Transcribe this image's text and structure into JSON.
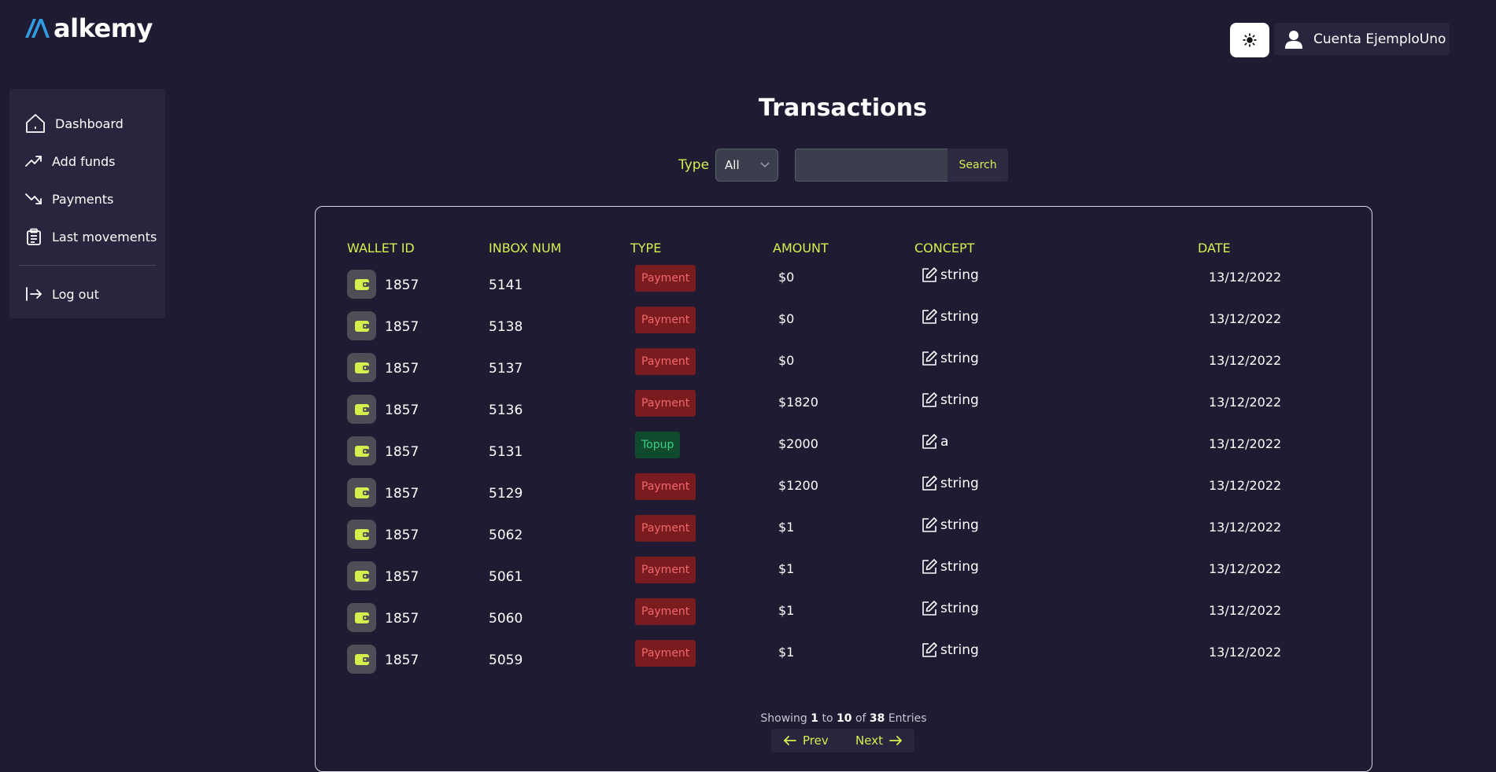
{
  "brand": {
    "name": "alkemy",
    "accent": "#2f9be0"
  },
  "header": {
    "theme_icon": "sun-icon",
    "account_name": "Cuenta EjemploUno",
    "account_icon": "user-icon"
  },
  "sidebar": {
    "items": [
      {
        "label": "Dashboard",
        "icon": "home-icon"
      },
      {
        "label": "Add funds",
        "icon": "trending-up-icon"
      },
      {
        "label": "Payments",
        "icon": "trending-down-icon"
      },
      {
        "label": "Last movements",
        "icon": "clipboard-icon"
      }
    ],
    "logout": {
      "label": "Log out",
      "icon": "logout-icon"
    }
  },
  "page": {
    "title": "Transactions"
  },
  "filters": {
    "type_label": "Type",
    "type_selected": "All",
    "search_value": "",
    "search_button": "Search"
  },
  "table": {
    "headers": [
      "WALLET ID",
      "INBOX NUM",
      "TYPE",
      "AMOUNT",
      "CONCEPT",
      "DATE"
    ],
    "rows": [
      {
        "wallet": "1857",
        "inbox": "5141",
        "type": "Payment",
        "amount": "$0",
        "concept": "string",
        "date": "13/12/2022"
      },
      {
        "wallet": "1857",
        "inbox": "5138",
        "type": "Payment",
        "amount": "$0",
        "concept": "string",
        "date": "13/12/2022"
      },
      {
        "wallet": "1857",
        "inbox": "5137",
        "type": "Payment",
        "amount": "$0",
        "concept": "string",
        "date": "13/12/2022"
      },
      {
        "wallet": "1857",
        "inbox": "5136",
        "type": "Payment",
        "amount": "$1820",
        "concept": "string",
        "date": "13/12/2022"
      },
      {
        "wallet": "1857",
        "inbox": "5131",
        "type": "Topup",
        "amount": "$2000",
        "concept": "a",
        "date": "13/12/2022"
      },
      {
        "wallet": "1857",
        "inbox": "5129",
        "type": "Payment",
        "amount": "$1200",
        "concept": "string",
        "date": "13/12/2022"
      },
      {
        "wallet": "1857",
        "inbox": "5062",
        "type": "Payment",
        "amount": "$1",
        "concept": "string",
        "date": "13/12/2022"
      },
      {
        "wallet": "1857",
        "inbox": "5061",
        "type": "Payment",
        "amount": "$1",
        "concept": "string",
        "date": "13/12/2022"
      },
      {
        "wallet": "1857",
        "inbox": "5060",
        "type": "Payment",
        "amount": "$1",
        "concept": "string",
        "date": "13/12/2022"
      },
      {
        "wallet": "1857",
        "inbox": "5059",
        "type": "Payment",
        "amount": "$1",
        "concept": "string",
        "date": "13/12/2022"
      }
    ]
  },
  "pagination": {
    "showing": "Showing",
    "from": "1",
    "to_word": "to",
    "to": "10",
    "of_word": "of",
    "total": "38",
    "entries": "Entries",
    "prev_label": "Prev",
    "next_label": "Next"
  },
  "colors": {
    "background": "#1f1b33",
    "panel": "#29253f",
    "accent_text": "#d6ef4d",
    "payment_bg": "#7a1b1f",
    "payment_text": "#f0686b",
    "topup_bg": "#0f4a2c",
    "topup_text": "#3ad086"
  }
}
